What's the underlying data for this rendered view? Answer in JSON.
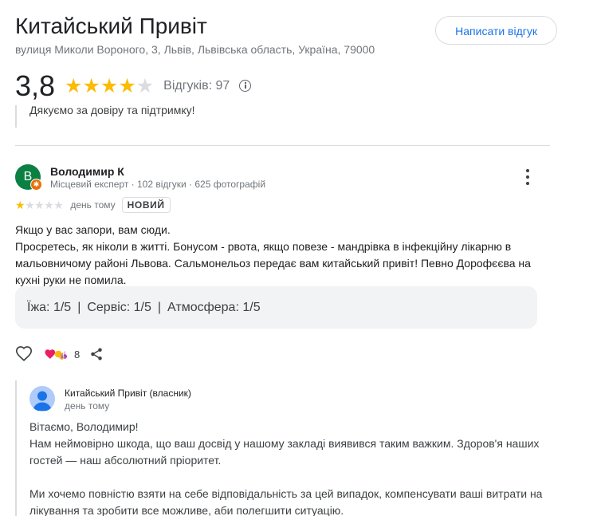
{
  "place": {
    "name": "Китайський Привіт",
    "address": "вулиця Миколи Вороного, 3, Львів, Львівська область, Україна, 79000",
    "write_review_label": "Написати відгук",
    "rating": "3,8",
    "rating_value": 3.8,
    "reviews_label": "Відгуків: 97"
  },
  "previous_reply_tail": "Дякуємо за довіру та підтримку!",
  "review": {
    "avatar_letter": "В",
    "avatar_color": "#0b8043",
    "author": "Володимир К",
    "author_meta": "Місцевий експерт · 102 відгуки · 625 фотографій",
    "stars": 1,
    "date": "день тому",
    "badge": "НОВИЙ",
    "text_lines": [
      "Якщо у вас запори, вам сюди.",
      "Просретесь, як ніколи в житті. Бонусом - рвота, якщо повезе - мандрівка в інфекційну лікарню в мальовничому районі Львова. Сальмонельоз передає вам китайський привіт! Певно Дорофєєва на кухні руки не помила."
    ],
    "aspects": {
      "food": "Їжа: 1/5",
      "service": "Сервіс: 1/5",
      "atmosphere": "Атмосфера: 1/5",
      "separator": "|"
    },
    "reaction_count": "8",
    "icons": {
      "like": "heart-outline-icon",
      "reactions": "reaction-emoji-icons",
      "share": "share-icon",
      "more": "more-vert-icon"
    }
  },
  "owner_reply": {
    "author": "Китайський Привіт (власник)",
    "date": "день тому",
    "paragraphs": [
      "Вітаємо, Володимир!",
      "Нам неймовірно шкода, що ваш досвід у нашому закладі виявився таким важким. Здоров'я наших гостей — наш абсолютний пріоритет.",
      "",
      "Ми хочемо повністю взяти на себе відповідальність за цей випадок, компенсувати ваші витрати на лікування та зробити все можливе, аби полегшити ситуацію."
    ]
  },
  "colors": {
    "star": "#fbbc04",
    "accent": "#1a73e8",
    "badge": "#e8710a"
  }
}
